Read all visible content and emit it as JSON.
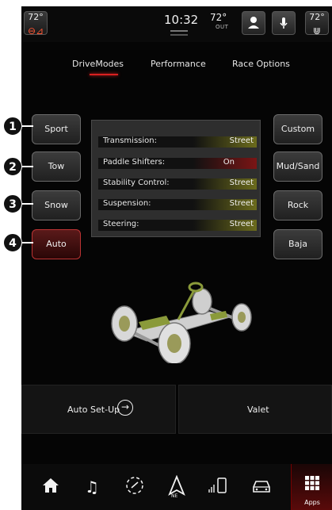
{
  "status_bar": {
    "driver_temp": "72°",
    "time": "10:32",
    "outside_temp": "72°",
    "outside_label": "OUT",
    "passenger_temp": "72°"
  },
  "tabs": [
    {
      "label": "DriveModes",
      "active": true
    },
    {
      "label": "Performance",
      "active": false
    },
    {
      "label": "Race Options",
      "active": false
    }
  ],
  "left_modes": [
    {
      "label": "Sport",
      "callout": "1",
      "active": false
    },
    {
      "label": "Tow",
      "callout": "2",
      "active": false
    },
    {
      "label": "Snow",
      "callout": "3",
      "active": false
    },
    {
      "label": "Auto",
      "callout": "4",
      "active": true
    }
  ],
  "right_modes": [
    {
      "label": "Custom"
    },
    {
      "label": "Mud/Sand"
    },
    {
      "label": "Rock"
    },
    {
      "label": "Baja"
    }
  ],
  "settings": [
    {
      "label": "Transmission:",
      "value": "Street",
      "status": "yellow"
    },
    {
      "label": "Paddle Shifters:",
      "value": "On",
      "status": "red"
    },
    {
      "label": "Stability Control:",
      "value": "Street",
      "status": "yellow"
    },
    {
      "label": "Suspension:",
      "value": "Street",
      "status": "yellow"
    },
    {
      "label": "Steering:",
      "value": "Street",
      "status": "yellow"
    }
  ],
  "actions": {
    "auto_setup": "Auto Set-Up",
    "valet": "Valet"
  },
  "nav": {
    "apps_label": "Apps",
    "compass_label": "NE",
    "items": [
      "home-icon",
      "music-icon",
      "controls-icon",
      "navigation-icon",
      "phone-icon",
      "vehicle-icon",
      "apps-icon"
    ]
  },
  "colors": {
    "accent_red": "#d92020",
    "setting_yellow": "#6b6b1c",
    "setting_red": "#7a1515"
  }
}
